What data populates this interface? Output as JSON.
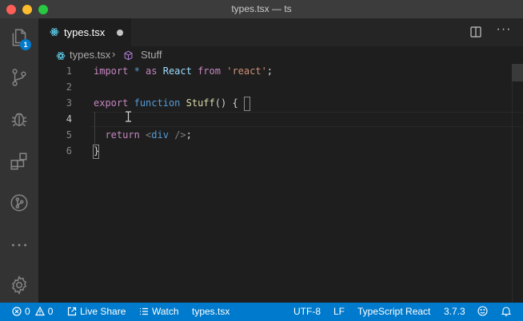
{
  "window": {
    "title": "types.tsx — ts"
  },
  "activity_bar": {
    "explorer_badge": "1"
  },
  "tabs": [
    {
      "label": "types.tsx",
      "dirty": true
    }
  ],
  "breadcrumbs": {
    "file": "types.tsx",
    "separator": "›",
    "symbol": "Stuff"
  },
  "editor": {
    "line_numbers": [
      "1",
      "2",
      "3",
      "4",
      "5",
      "6"
    ],
    "lines": {
      "l1": {
        "t1": "import",
        "t2": " * ",
        "t3": "as",
        "t4": " React ",
        "t5": "from",
        "t6": " ",
        "t7": "'react'",
        "t8": ";"
      },
      "l3": {
        "t1": "export",
        "t2": " ",
        "t3": "function",
        "t4": " ",
        "t5": "Stuff",
        "t6": "() ",
        "t7": "{"
      },
      "l5": {
        "t1": "  ",
        "t2": "return",
        "t3": " ",
        "t4": "<",
        "t5": "div",
        "t6": " />",
        "t7": ";"
      },
      "l6": {
        "t1": "}"
      }
    }
  },
  "status_bar": {
    "errors": "0",
    "warnings": "0",
    "live_share": "Live Share",
    "watch": "Watch",
    "active_file": "types.tsx",
    "encoding": "UTF-8",
    "eol": "LF",
    "language": "TypeScript React",
    "ts_version": "3.7.3"
  },
  "colors": {
    "status_bar": "#007acc",
    "activity_bar": "#333333",
    "editor_bg": "#1e1e1e",
    "keyword": "#c586c0",
    "function": "#dcdcaa",
    "string": "#ce9178"
  },
  "icons": [
    "explorer-icon",
    "source-control-icon",
    "debug-icon",
    "extensions-icon",
    "live-share-icon",
    "more-icon",
    "settings-gear-icon",
    "react-file-icon",
    "split-editor-icon",
    "symbol-icon",
    "error-icon",
    "warning-icon",
    "feedback-smiley-icon",
    "bell-icon"
  ]
}
